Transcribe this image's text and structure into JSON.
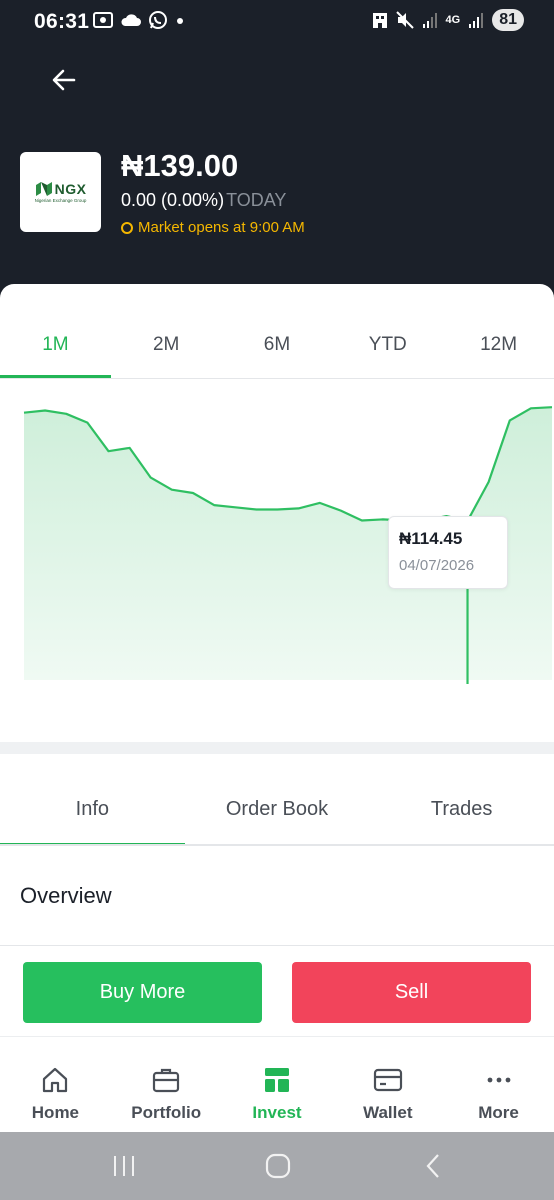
{
  "status_bar": {
    "time": "06:31",
    "network": "4G",
    "battery": "81"
  },
  "stock": {
    "logo_text": "NGX",
    "logo_subtext": "Nigerian Exchange Group",
    "price": "₦139.00",
    "change": "0.00 (0.00%)",
    "change_period": "TODAY",
    "market_status": "Market opens at 9:00 AM"
  },
  "colors": {
    "accent": "#22b556",
    "danger": "#f2445b",
    "header_bg": "#1b2029",
    "market_status": "#f5b700"
  },
  "range_tabs": [
    {
      "label": "1M",
      "active": true
    },
    {
      "label": "2M",
      "active": false
    },
    {
      "label": "6M",
      "active": false
    },
    {
      "label": "YTD",
      "active": false
    },
    {
      "label": "12M",
      "active": false
    }
  ],
  "chart_data": {
    "type": "area",
    "title": "",
    "xlabel": "",
    "ylabel": "",
    "values": [
      124.3,
      124.5,
      124.2,
      123.4,
      120.8,
      121.1,
      118.4,
      117.3,
      117.0,
      115.9,
      115.7,
      115.5,
      115.5,
      115.6,
      116.1,
      115.4,
      114.5,
      114.6,
      114.5,
      114.5,
      114.9,
      114.45,
      118.0,
      123.6,
      124.7,
      124.8
    ],
    "selected_index": 21,
    "selected_price": "₦114.45",
    "selected_date": "04/07/2026",
    "grid": false,
    "legend": "none"
  },
  "info_tabs": [
    {
      "label": "Info",
      "active": true
    },
    {
      "label": "Order Book",
      "active": false
    },
    {
      "label": "Trades",
      "active": false
    }
  ],
  "overview_title": "Overview",
  "actions": {
    "buy_label": "Buy More",
    "sell_label": "Sell"
  },
  "bottom_nav": [
    {
      "label": "Home",
      "icon": "home-icon",
      "active": false
    },
    {
      "label": "Portfolio",
      "icon": "briefcase-icon",
      "active": false
    },
    {
      "label": "Invest",
      "icon": "invest-icon",
      "active": true
    },
    {
      "label": "Wallet",
      "icon": "wallet-icon",
      "active": false
    },
    {
      "label": "More",
      "icon": "more-dots-icon",
      "active": false
    }
  ]
}
